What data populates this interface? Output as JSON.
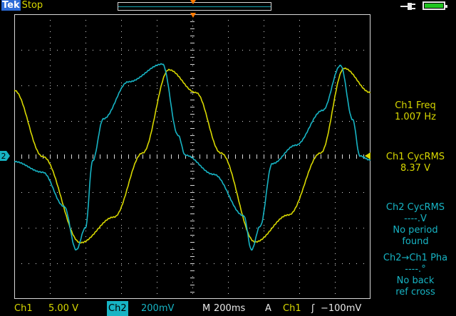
{
  "status": {
    "brand": "Tek",
    "state": "Stop"
  },
  "measurements": {
    "ch1_freq_label": "Ch1 Freq",
    "ch1_freq_value": "1.007 Hz",
    "ch1_rms_label": "Ch1 CycRMS",
    "ch1_rms_value": "8.37 V",
    "ch2_rms_label": "Ch2 CycRMS",
    "ch2_rms_value": "----.V",
    "ch2_rms_note1": "No period",
    "ch2_rms_note2": "found",
    "phase_label": "Ch2→Ch1 Pha",
    "phase_value": "----.°",
    "phase_note1": "No back",
    "phase_note2": "ref cross"
  },
  "settings": {
    "ch1_label": "Ch1",
    "ch1_scale": "5.00 V",
    "ch2_label": "Ch2",
    "ch2_scale": "200mV",
    "timebase_label": "M",
    "timebase_value": "200ms",
    "trigger_mode": "A",
    "trigger_source": "Ch1",
    "trigger_slope": "ʃ",
    "trigger_level": "−100mV"
  },
  "markers": {
    "ch2_ground": "2"
  },
  "colors": {
    "ch1": "#d8d800",
    "ch2": "#17b4c4",
    "trigger": "#ff7a00",
    "grid": "#d8d8d8",
    "battery": "#1fc41f"
  }
}
